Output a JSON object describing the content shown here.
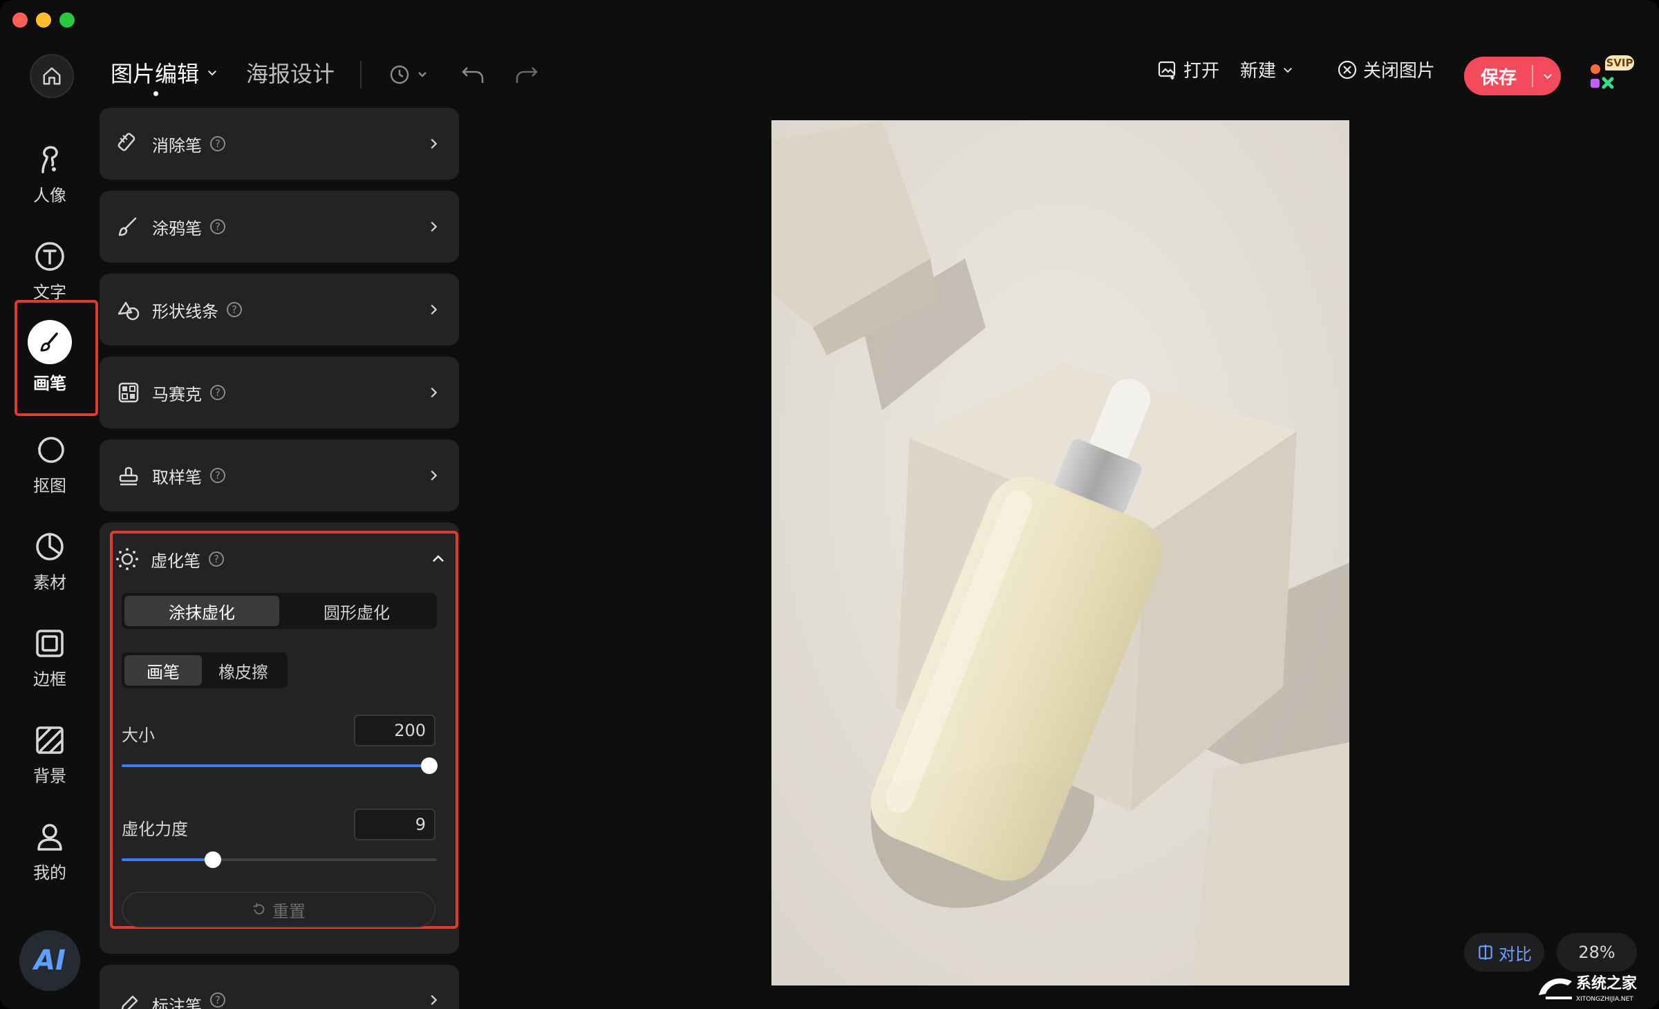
{
  "app": {
    "tabs": [
      {
        "label": "图片编辑",
        "active": true
      },
      {
        "label": "海报设计",
        "active": false
      }
    ]
  },
  "toolbar": {
    "open_label": "打开",
    "new_label": "新建",
    "close_label": "关闭图片",
    "save_label": "保存",
    "svip_label": "SVIP",
    "accent_color": "#f34b5b"
  },
  "rail": {
    "items": [
      {
        "label": "人像",
        "icon": "portrait-icon"
      },
      {
        "label": "文字",
        "icon": "text-icon"
      },
      {
        "label": "画笔",
        "icon": "brush-icon",
        "active": true
      },
      {
        "label": "抠图",
        "icon": "cutout-icon"
      },
      {
        "label": "素材",
        "icon": "material-icon"
      },
      {
        "label": "边框",
        "icon": "frame-icon"
      },
      {
        "label": "背景",
        "icon": "background-icon"
      },
      {
        "label": "我的",
        "icon": "user-icon"
      }
    ],
    "ai_label": "AI"
  },
  "panel": {
    "tools": [
      {
        "label": "消除笔",
        "icon": "eraser-pen-icon"
      },
      {
        "label": "涂鸦笔",
        "icon": "doodle-pen-icon"
      },
      {
        "label": "形状线条",
        "icon": "shape-icon"
      },
      {
        "label": "马赛克",
        "icon": "mosaic-icon"
      },
      {
        "label": "取样笔",
        "icon": "stamp-icon"
      }
    ],
    "blur": {
      "title": "虚化笔",
      "modes": [
        "涂抹虚化",
        "圆形虚化"
      ],
      "active_mode": "涂抹虚化",
      "tools": [
        "画笔",
        "橡皮擦"
      ],
      "active_tool": "画笔",
      "size_label": "大小",
      "size_value": "200",
      "size_fraction": 0.975,
      "strength_label": "虚化力度",
      "strength_value": "9",
      "strength_fraction": 0.29,
      "reset_label": "重置"
    },
    "annotate_label": "标注笔",
    "help_glyph": "?"
  },
  "canvas": {
    "compare_label": "对比",
    "zoom_label": "28%"
  },
  "watermark": {
    "line1": "系统之家",
    "line2": "XITONGZHIJIA.NET"
  }
}
